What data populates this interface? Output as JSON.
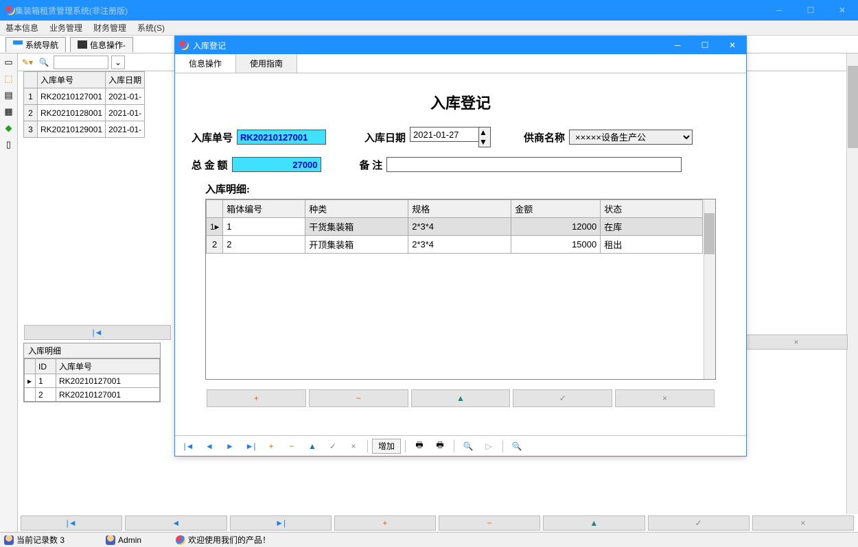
{
  "main": {
    "title": "集装箱租赁管理系统(非注册版)",
    "menu": {
      "basic": "基本信息",
      "business": "业务管理",
      "finance": "财务管理",
      "system": "系统(S)"
    },
    "tab1": "系统导航",
    "tab2": "信息操作-"
  },
  "back_grid": {
    "col1": "入库单号",
    "col2": "入库日期",
    "rows": [
      {
        "n": "1",
        "id": "RK20210127001",
        "date": "2021-01-"
      },
      {
        "n": "2",
        "id": "RK20210128001",
        "date": "2021-01-"
      },
      {
        "n": "3",
        "id": "RK20210129001",
        "date": "2021-01-"
      }
    ]
  },
  "detail_panel": {
    "title": "入库明细",
    "col_id": "ID",
    "col_no": "入库单号",
    "rows": [
      {
        "id": "1",
        "no": "RK20210127001"
      },
      {
        "id": "2",
        "no": "RK20210127001"
      }
    ]
  },
  "dialog": {
    "title": "入库登记",
    "tab1": "信息操作",
    "tab2": "使用指南",
    "heading": "入库登记",
    "label_no": "入库单号",
    "value_no": "RK20210127001",
    "label_date": "入库日期",
    "value_date": "2021-01-27",
    "label_supplier": "供商名称",
    "value_supplier": "×××××设备生产公",
    "label_total": "总 金 额",
    "value_total": "27000",
    "label_remark": "备    注",
    "value_remark": "",
    "detail_label": "入库明细:",
    "cols": {
      "containerNo": "箱体编号",
      "type": "种类",
      "spec": "规格",
      "amount": "金额",
      "status": "状态"
    },
    "rows": [
      {
        "n": "1",
        "no": "1",
        "type": "干货集装箱",
        "spec": "2*3*4",
        "amount": "12000",
        "status": "在库"
      },
      {
        "n": "2",
        "no": "2",
        "type": "开顶集装箱",
        "spec": "2*3*4",
        "amount": "15000",
        "status": "租出"
      }
    ],
    "toolbar": {
      "add": "增加"
    }
  },
  "status": {
    "records": "当前记录数 3",
    "user": "Admin",
    "welcome": "欢迎使用我们的产品！"
  },
  "glyphs": {
    "first": "|◄",
    "prev": "◄",
    "next": "►",
    "last": "►|",
    "plus": "+",
    "minus": "−",
    "up": "▲",
    "check": "✓",
    "close": "×",
    "pencil": "✎",
    "search": "🔍",
    "print": "🖨",
    "play": "▷"
  }
}
